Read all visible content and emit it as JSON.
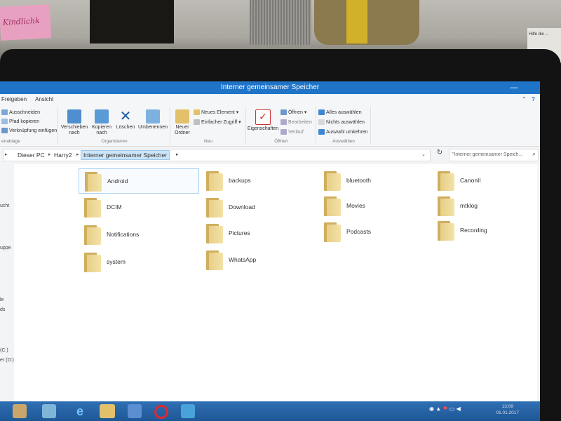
{
  "background": {
    "sticky_note_text": "Kindlichk",
    "paper_note_text": "Hilfe die ..."
  },
  "window": {
    "title": "Interner gemeinsamer Speicher",
    "minimize": "—",
    "maximize": "□",
    "help": "?",
    "collapse": "⌃"
  },
  "tabs": [
    "Freigeben",
    "Ansicht"
  ],
  "ribbon": {
    "clipboard": {
      "cut": "Ausschneiden",
      "copy_path": "Pfad kopieren",
      "paste_shortcut": "Verknüpfung einfügen",
      "label": "enablage"
    },
    "organize": {
      "move_to": "Verschieben nach",
      "copy_to": "Kopieren nach",
      "delete": "Löschen",
      "rename": "Umbenennen",
      "label": "Organisieren"
    },
    "new": {
      "new_folder": "Neuer Ordner",
      "new_item": "Neues Element",
      "easy_access": "Einfacher Zugriff",
      "label": "Neu"
    },
    "open": {
      "properties": "Eigenschaften",
      "open": "Öffnen",
      "edit": "Bearbeiten",
      "history": "Verlauf",
      "label": "Öffnen"
    },
    "select": {
      "select_all": "Alles auswählen",
      "select_none": "Nichts auswählen",
      "invert": "Auswahl umkehren",
      "label": "Auswählen"
    }
  },
  "address": {
    "crumbs": [
      "Dieser PC",
      "Harry2",
      "Interner gemeinsamer Speicher"
    ],
    "search_placeholder": "\"Interner gemeinsamer Speich..."
  },
  "nav_fragments": [
    "ucht",
    "uppe",
    "le",
    "ds",
    "(C:)",
    "er (D:)"
  ],
  "folders": [
    {
      "name": "Android",
      "selected": true
    },
    {
      "name": "backups"
    },
    {
      "name": "bluetooth"
    },
    {
      "name": "CanonII"
    },
    {
      "name": "DCIM"
    },
    {
      "name": "Download"
    },
    {
      "name": "Movies"
    },
    {
      "name": "mtklog"
    },
    {
      "name": "Notifications"
    },
    {
      "name": "Pictures"
    },
    {
      "name": "Podcasts"
    },
    {
      "name": "Recording"
    },
    {
      "name": "system"
    },
    {
      "name": "WhatsApp"
    }
  ],
  "taskbar": {
    "time": "13:09",
    "date": "01.01.2017"
  },
  "colors": {
    "titlebar": "#1f74c8",
    "selection": "#cce4f7",
    "taskbar": "#2f6fb4",
    "folder": "#e7cf87"
  }
}
